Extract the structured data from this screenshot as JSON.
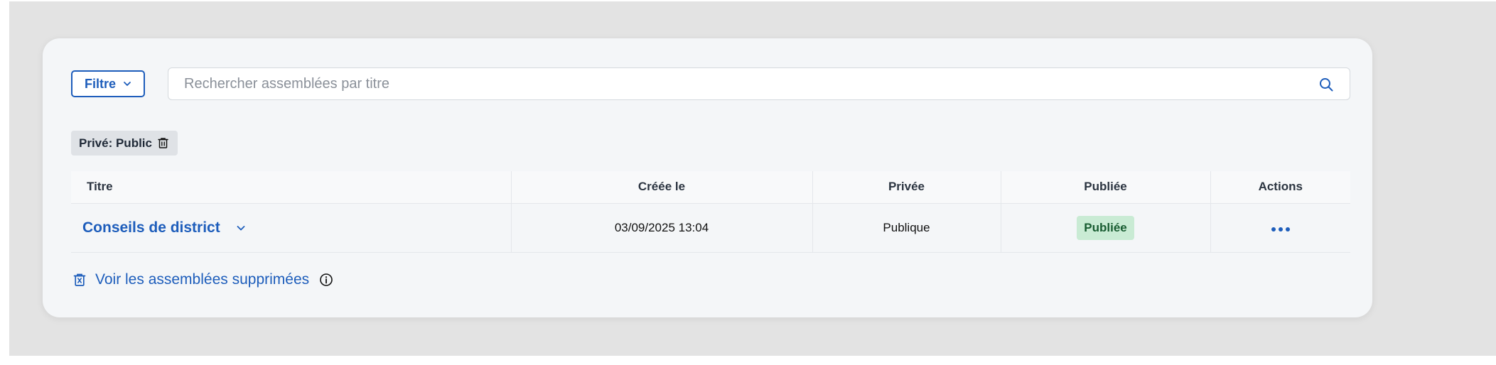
{
  "filter": {
    "label": "Filtre",
    "icon": "chevron-down-icon"
  },
  "search": {
    "placeholder": "Rechercher assemblées par titre",
    "value": "",
    "icon": "search-icon"
  },
  "active_filter_chip": {
    "label": "Privé: Public",
    "icon": "trash-icon"
  },
  "table": {
    "columns": [
      "Titre",
      "Créée le",
      "Privée",
      "Publiée",
      "Actions"
    ],
    "rows": [
      {
        "title": "Conseils de district",
        "created": "03/09/2025 13:04",
        "private": "Publique",
        "published": "Publiée",
        "actions_icon": "more-icon"
      }
    ]
  },
  "deleted_link": {
    "label": "Voir les assemblées supprimées",
    "icon": "trash-icon",
    "info_icon": "info-icon"
  },
  "colors": {
    "accent": "#1d5dbb",
    "badge_bg": "#c9ebd4",
    "badge_text": "#185c31",
    "card_bg": "#f4f6f8",
    "backdrop": "#e3e3e3"
  }
}
